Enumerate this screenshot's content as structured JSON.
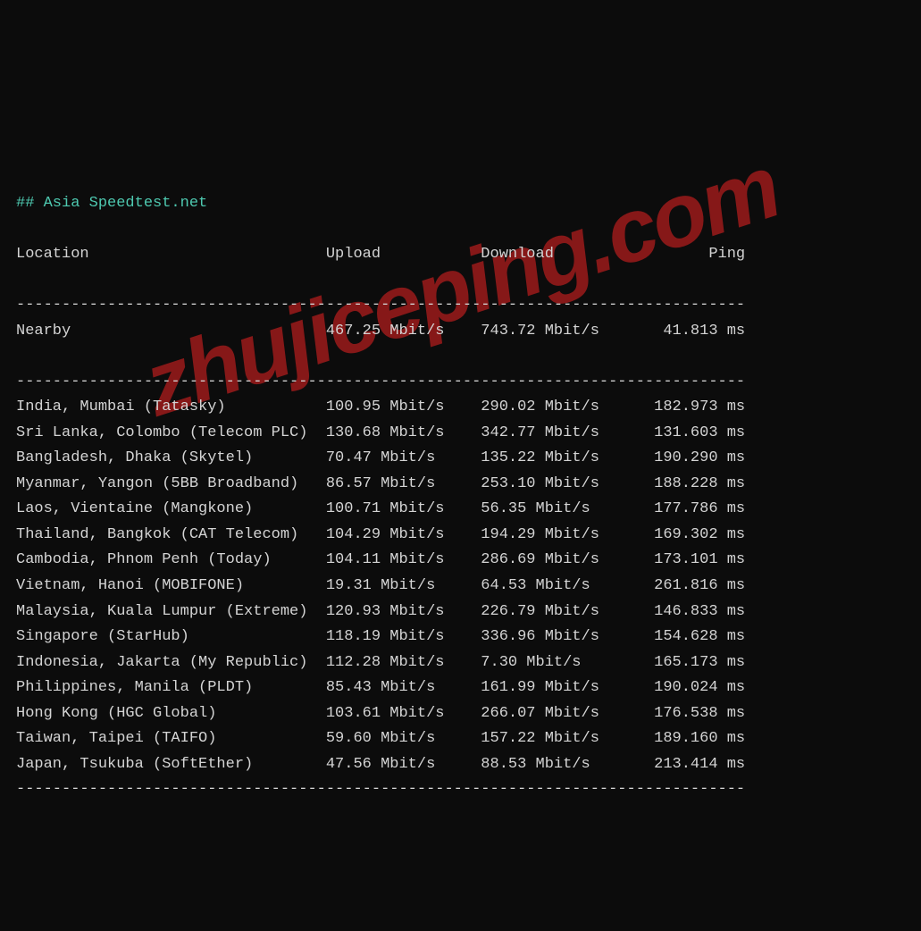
{
  "title": "## Asia Speedtest.net",
  "watermark": "zhujiceping.com",
  "columns": {
    "location": "Location",
    "upload": "Upload",
    "download": "Download",
    "ping": "Ping"
  },
  "nearby": {
    "label": "Nearby",
    "upload": "467.25 Mbit/s",
    "download": "743.72 Mbit/s",
    "ping": "41.813 ms"
  },
  "rows": [
    {
      "location": "India, Mumbai (Tatasky)",
      "upload": "100.95 Mbit/s",
      "download": "290.02 Mbit/s",
      "ping": "182.973 ms"
    },
    {
      "location": "Sri Lanka, Colombo (Telecom PLC)",
      "upload": "130.68 Mbit/s",
      "download": "342.77 Mbit/s",
      "ping": "131.603 ms"
    },
    {
      "location": "Bangladesh, Dhaka (Skytel)",
      "upload": "70.47 Mbit/s",
      "download": "135.22 Mbit/s",
      "ping": "190.290 ms"
    },
    {
      "location": "Myanmar, Yangon (5BB Broadband)",
      "upload": "86.57 Mbit/s",
      "download": "253.10 Mbit/s",
      "ping": "188.228 ms"
    },
    {
      "location": "Laos, Vientaine (Mangkone)",
      "upload": "100.71 Mbit/s",
      "download": "56.35 Mbit/s",
      "ping": "177.786 ms"
    },
    {
      "location": "Thailand, Bangkok (CAT Telecom)",
      "upload": "104.29 Mbit/s",
      "download": "194.29 Mbit/s",
      "ping": "169.302 ms"
    },
    {
      "location": "Cambodia, Phnom Penh (Today)",
      "upload": "104.11 Mbit/s",
      "download": "286.69 Mbit/s",
      "ping": "173.101 ms"
    },
    {
      "location": "Vietnam, Hanoi (MOBIFONE)",
      "upload": "19.31 Mbit/s",
      "download": "64.53 Mbit/s",
      "ping": "261.816 ms"
    },
    {
      "location": "Malaysia, Kuala Lumpur (Extreme)",
      "upload": "120.93 Mbit/s",
      "download": "226.79 Mbit/s",
      "ping": "146.833 ms"
    },
    {
      "location": "Singapore (StarHub)",
      "upload": "118.19 Mbit/s",
      "download": "336.96 Mbit/s",
      "ping": "154.628 ms"
    },
    {
      "location": "Indonesia, Jakarta (My Republic)",
      "upload": "112.28 Mbit/s",
      "download": "7.30 Mbit/s",
      "ping": "165.173 ms"
    },
    {
      "location": "Philippines, Manila (PLDT)",
      "upload": "85.43 Mbit/s",
      "download": "161.99 Mbit/s",
      "ping": "190.024 ms"
    },
    {
      "location": "Hong Kong (HGC Global)",
      "upload": "103.61 Mbit/s",
      "download": "266.07 Mbit/s",
      "ping": "176.538 ms"
    },
    {
      "location": "Taiwan, Taipei (TAIFO)",
      "upload": "59.60 Mbit/s",
      "download": "157.22 Mbit/s",
      "ping": "189.160 ms"
    },
    {
      "location": "Japan, Tsukuba (SoftEther)",
      "upload": "47.56 Mbit/s",
      "download": "88.53 Mbit/s",
      "ping": "213.414 ms"
    }
  ]
}
